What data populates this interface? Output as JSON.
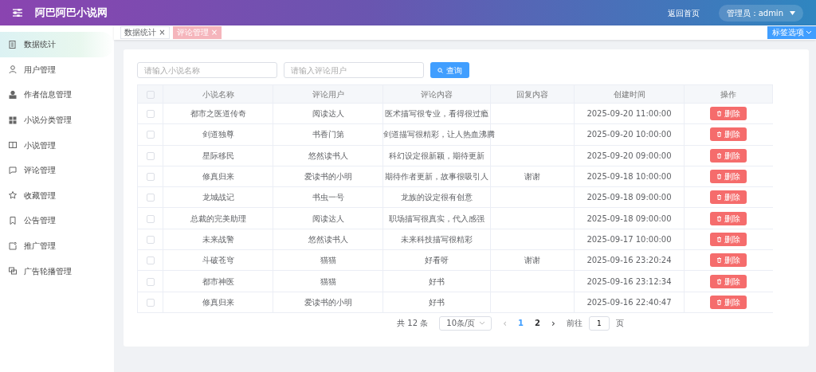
{
  "header": {
    "title": "阿巴阿巴小说网",
    "home_link": "返回首页",
    "user_menu": "管理员：admin"
  },
  "sidebar": {
    "items": [
      {
        "label": "数据统计",
        "selected": true
      },
      {
        "label": "用户管理",
        "selected": false
      },
      {
        "label": "作者信息管理",
        "selected": false
      },
      {
        "label": "小说分类管理",
        "selected": false
      },
      {
        "label": "小说管理",
        "selected": false
      },
      {
        "label": "评论管理",
        "selected": false
      },
      {
        "label": "收藏管理",
        "selected": false
      },
      {
        "label": "公告管理",
        "selected": false
      },
      {
        "label": "推广管理",
        "selected": false
      },
      {
        "label": "广告轮播管理",
        "selected": false
      }
    ]
  },
  "tabs": [
    {
      "label": "数据统计",
      "close": "×",
      "selected": false
    },
    {
      "label": "评论管理",
      "close": "×",
      "selected": true
    }
  ],
  "tab_options": "标签选项",
  "search": {
    "fields": [
      {
        "placeholder": "请输入小说名称"
      },
      {
        "placeholder": "请输入评论用户"
      }
    ],
    "button": "查询"
  },
  "table": {
    "select_all_checked": false,
    "columns": [
      "小说名称",
      "评论用户",
      "评论内容",
      "回复内容",
      "创建时间",
      "操作"
    ],
    "rows": [
      {
        "checked": false,
        "cells": [
          "都市之医道传奇",
          "阅读达人",
          "医术描写很专业，看得很过瘾",
          "",
          "2025-09-20 11:00:00"
        ],
        "action": "删除"
      },
      {
        "checked": false,
        "cells": [
          "剑道独尊",
          "书香门第",
          "剑道描写很精彩，让人热血沸腾",
          "",
          "2025-09-20 10:00:00"
        ],
        "action": "删除"
      },
      {
        "checked": false,
        "cells": [
          "星际移民",
          "悠然读书人",
          "科幻设定很新颖，期待更新",
          "",
          "2025-09-20 09:00:00"
        ],
        "action": "删除"
      },
      {
        "checked": false,
        "cells": [
          "修真归来",
          "爱读书的小明",
          "期待作者更新，故事很吸引人",
          "谢谢",
          "2025-09-18 10:00:00"
        ],
        "action": "删除"
      },
      {
        "checked": false,
        "cells": [
          "龙城战记",
          "书虫一号",
          "龙族的设定很有创意",
          "",
          "2025-09-18 09:00:00"
        ],
        "action": "删除"
      },
      {
        "checked": false,
        "cells": [
          "总裁的完美助理",
          "阅读达人",
          "职场描写很真实，代入感强",
          "",
          "2025-09-18 09:00:00"
        ],
        "action": "删除"
      },
      {
        "checked": false,
        "cells": [
          "未来战警",
          "悠然读书人",
          "未来科技描写很精彩",
          "",
          "2025-09-17 10:00:00"
        ],
        "action": "删除"
      },
      {
        "checked": false,
        "cells": [
          "斗破苍穹",
          "猫猫",
          "好看呀",
          "谢谢",
          "2025-09-16 23:20:24"
        ],
        "action": "删除"
      },
      {
        "checked": false,
        "cells": [
          "都市神医",
          "猫猫",
          "好书",
          "",
          "2025-09-16 23:12:34"
        ],
        "action": "删除"
      },
      {
        "checked": false,
        "cells": [
          "修真归来",
          "爱读书的小明",
          "好书",
          "",
          "2025-09-16 22:40:47"
        ],
        "action": "删除"
      }
    ]
  },
  "pagination": {
    "total": "共 12 条",
    "page_size": "10条/页",
    "prev": "‹",
    "pages": [
      {
        "label": "1",
        "selected": true
      },
      {
        "label": "2",
        "selected": false
      }
    ],
    "next": "›",
    "goto_label": "前往",
    "goto_value": "1",
    "goto_suffix": "页"
  }
}
